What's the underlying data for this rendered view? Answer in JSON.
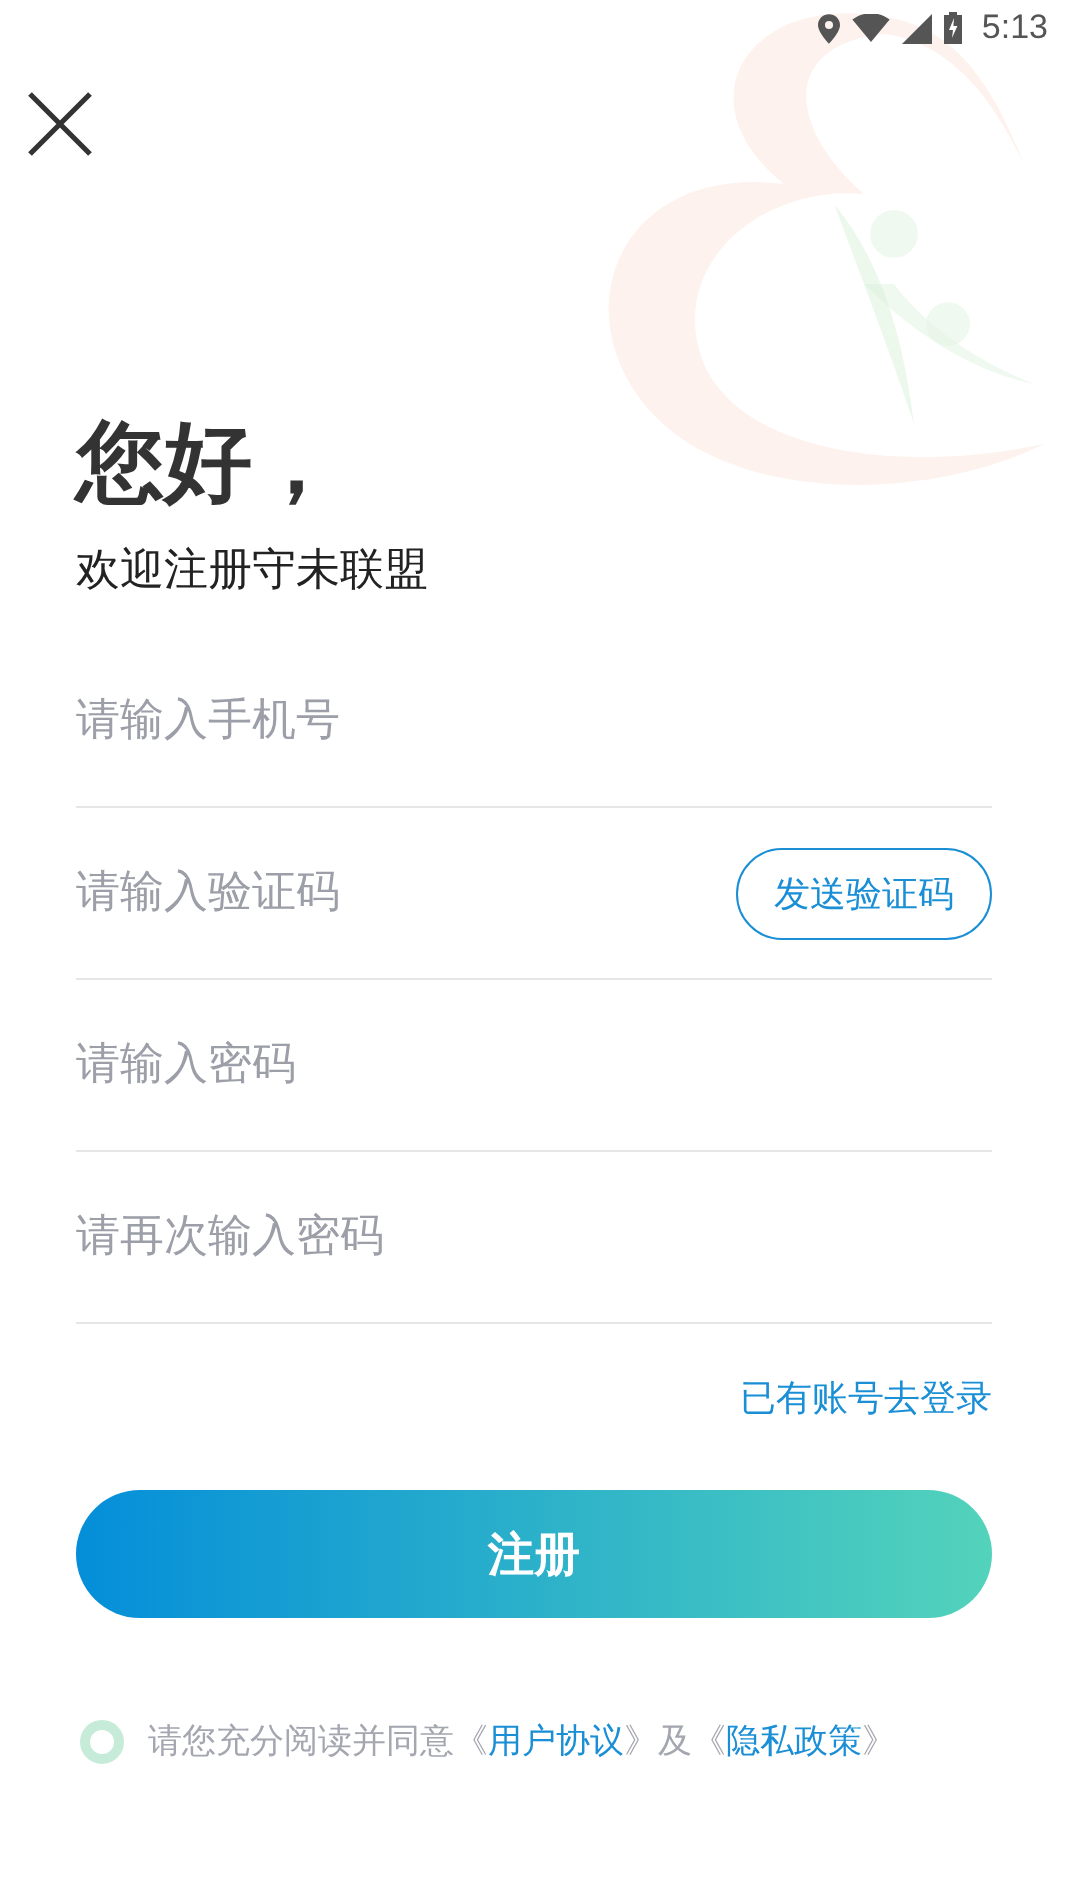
{
  "status_bar": {
    "time": "5:13"
  },
  "heading": "您好，",
  "subtitle": "欢迎注册守未联盟",
  "fields": [
    {
      "kind": "plain",
      "placeholder": "请输入手机号"
    },
    {
      "kind": "code",
      "placeholder": "请输入验证码",
      "button": "发送验证码"
    },
    {
      "kind": "plain",
      "placeholder": "请输入密码"
    },
    {
      "kind": "plain",
      "placeholder": "请再次输入密码"
    }
  ],
  "login_link": "已有账号去登录",
  "register_button": "注册",
  "agreement": {
    "checked": false,
    "parts": [
      {
        "kind": "text",
        "text": "请您充分阅读并同意《"
      },
      {
        "kind": "link",
        "text": "用户协议"
      },
      {
        "kind": "text",
        "text": "》及《"
      },
      {
        "kind": "link",
        "text": "隐私政策"
      },
      {
        "kind": "text",
        "text": "》"
      }
    ]
  }
}
